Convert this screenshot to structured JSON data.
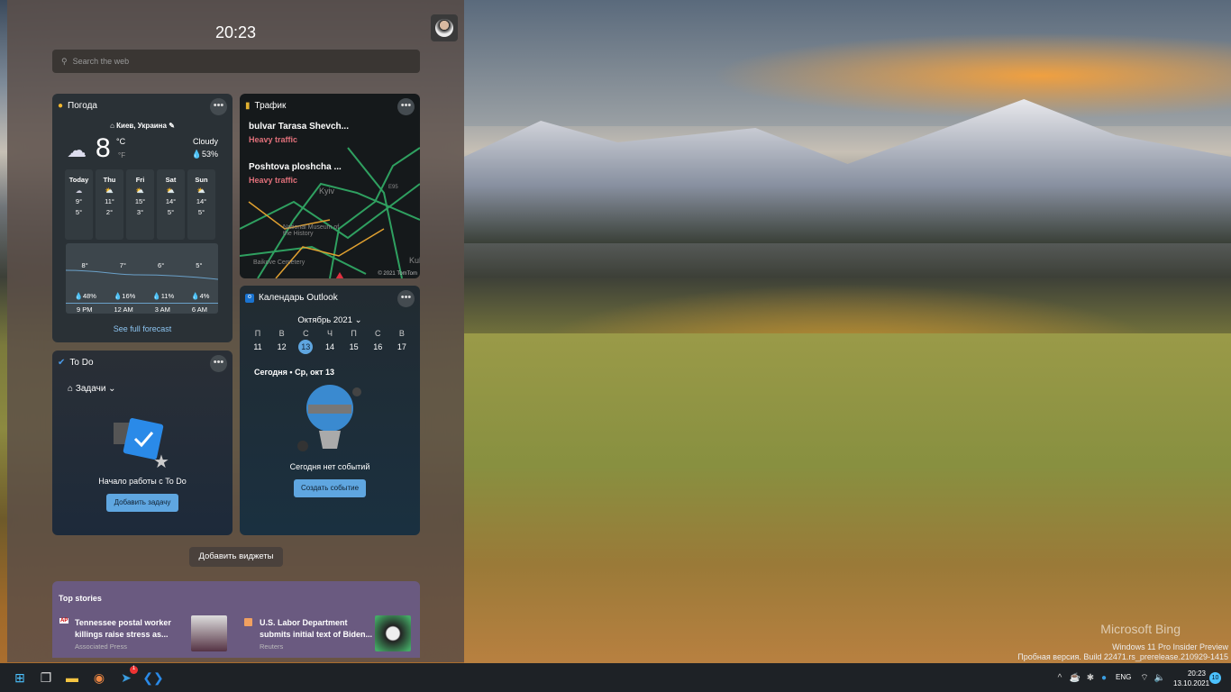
{
  "desktop": {
    "watermark": "Microsoft Bing",
    "build_line1": "Windows 11 Pro Insider Preview",
    "build_line2": "Пробная версия. Build 22471.rs_prerelease.210929-1415"
  },
  "widgets": {
    "time": "20:23",
    "search_placeholder": "Search the web",
    "add_widgets": "Добавить виджеты",
    "weather": {
      "title": "Погода",
      "location": "Киев, Украина",
      "temp": "8",
      "unit_c": "°C",
      "unit_f": "°F",
      "condition": "Cloudy",
      "humidity": "53%",
      "days": [
        {
          "d": "Today",
          "hi": "9°",
          "lo": "5°"
        },
        {
          "d": "Thu",
          "hi": "11°",
          "lo": "2°"
        },
        {
          "d": "Fri",
          "hi": "15°",
          "lo": "3°"
        },
        {
          "d": "Sat",
          "hi": "14°",
          "lo": "5°"
        },
        {
          "d": "Sun",
          "hi": "14°",
          "lo": "5°"
        }
      ],
      "hours": [
        {
          "t": "9 PM",
          "temp": "8°",
          "rain": "48%"
        },
        {
          "t": "12 AM",
          "temp": "7°",
          "rain": "16%"
        },
        {
          "t": "3 AM",
          "temp": "6°",
          "rain": "11%"
        },
        {
          "t": "6 AM",
          "temp": "5°",
          "rain": "4%"
        }
      ],
      "full": "See full forecast"
    },
    "traffic": {
      "title": "Трафик",
      "items": [
        {
          "road": "bulvar Tarasa Shevch...",
          "status": "Heavy traffic"
        },
        {
          "road": "Poshtova ploshcha ...",
          "status": "Heavy traffic"
        }
      ],
      "map_labels": [
        "Kyiv",
        "National Museum of the History",
        "Baikove Cemetery",
        "Kuk"
      ],
      "copyright": "© 2021 TomTom",
      "road_badge": "E95"
    },
    "calendar": {
      "title": "Календарь Outlook",
      "month": "Октябрь 2021",
      "weekdays": [
        "П",
        "В",
        "С",
        "Ч",
        "П",
        "С",
        "В"
      ],
      "dates": [
        "11",
        "12",
        "13",
        "14",
        "15",
        "16",
        "17"
      ],
      "today_label": "Сегодня • Ср, окт 13",
      "no_events": "Сегодня нет событий",
      "create": "Создать событие"
    },
    "todo": {
      "title": "To Do",
      "list": "Задачи",
      "start": "Начало работы с To Do",
      "add": "Добавить задачу"
    },
    "stories": {
      "title": "Top stories",
      "items": [
        {
          "source_badge": "AP",
          "headline1": "Tennessee postal worker",
          "headline2": "killings raise stress as...",
          "source": "Associated Press"
        },
        {
          "headline1": "U.S. Labor Department",
          "headline2": "submits initial text of Biden...",
          "source": "Reuters"
        }
      ]
    }
  },
  "taskbar": {
    "lang": "ENG",
    "time": "20:23",
    "date": "13.10.2021",
    "notifications": "10",
    "telegram_badge": "1"
  },
  "colors": {
    "accent": "#5fa6e0",
    "heavy_traffic": "#e0707a"
  }
}
